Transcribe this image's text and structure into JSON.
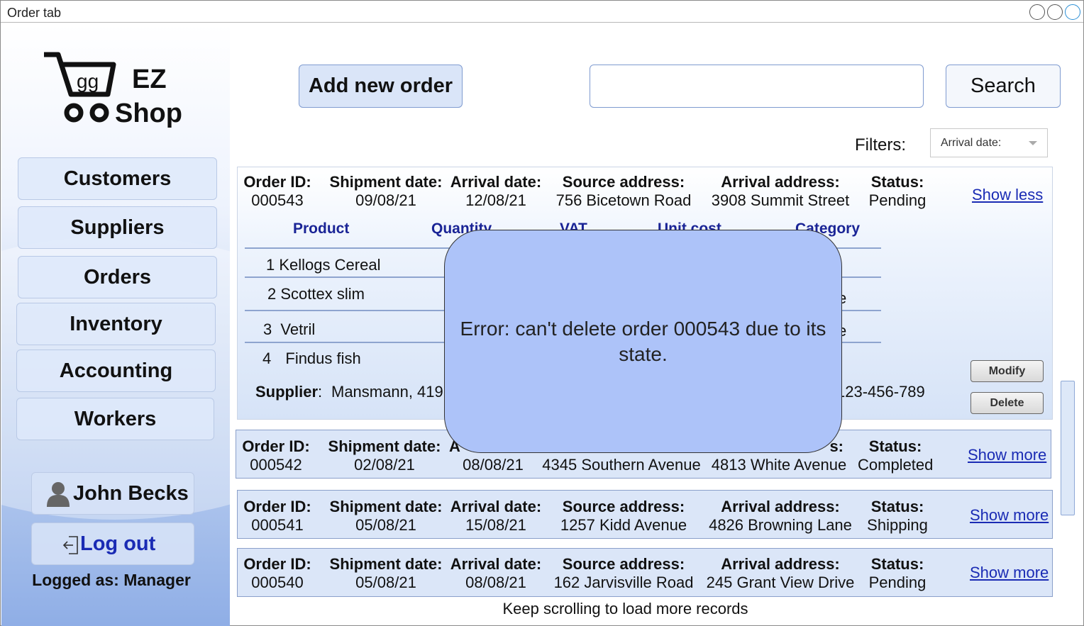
{
  "window": {
    "title": "Order tab"
  },
  "logo": {
    "cart_text": "gg",
    "line1": "EZ",
    "line2": "Shop"
  },
  "sidebar": {
    "items": [
      "Customers",
      "Suppliers",
      "Orders",
      "Inventory",
      "Accounting",
      "Workers"
    ],
    "user_name": "John Becks",
    "logout_label": "Log out",
    "logged_as": "Logged as: Manager"
  },
  "toolbar": {
    "add_label": "Add new order",
    "search_value": "",
    "search_label": "Search",
    "filters_label": "Filters:",
    "filter_value": "Arrival date:"
  },
  "labels": {
    "order_id": "Order ID:",
    "shipment": "Shipment date:",
    "arrival_date": "Arrival date:",
    "source": "Source address:",
    "arrival_address": "Arrival address:",
    "status": "Status:"
  },
  "expanded_order": {
    "id": "000543",
    "shipment": "09/08/21",
    "arrival": "12/08/21",
    "source": "756  Bicetown Road",
    "destination": "3908  Summit Street",
    "status": "Pending",
    "link": "Show less",
    "product_headers": {
      "product": "Product",
      "quantity": "Quantity",
      "vat": "VAT",
      "unit_cost": "Unit cost",
      "category": "Category"
    },
    "products": [
      {
        "num": "1",
        "name": "Kellogs Cereal",
        "category_tail": "l"
      },
      {
        "num": "2",
        "name": "Scottex slim",
        "category_tail": "e"
      },
      {
        "num": "3",
        "name": "Vetril",
        "category_tail": "e"
      },
      {
        "num": "4",
        "name": "Findus fish",
        "category_tail": ""
      }
    ],
    "supplier_label": "Supplier",
    "supplier_text": "Mansmann,  419",
    "phone_tail": "123-456-789",
    "modify_label": "Modify",
    "delete_label": "Delete"
  },
  "orders": [
    {
      "id": "000542",
      "shipment": "02/08/21",
      "arrival": "08/08/21",
      "source": "4345  Southern Avenue",
      "destination": "4813  White Avenue",
      "status": "Completed",
      "link": "Show more",
      "arrival_label_partial": "A",
      "addr_label_tail": "s:"
    },
    {
      "id": "000541",
      "shipment": "05/08/21",
      "arrival": "15/08/21",
      "source": "1257  Kidd Avenue",
      "destination": "4826  Browning Lane",
      "status": "Shipping",
      "link": "Show more"
    },
    {
      "id": "000540",
      "shipment": "05/08/21",
      "arrival": "08/08/21",
      "source": "162  Jarvisville Road",
      "destination": "245  Grant View Drive",
      "status": "Pending",
      "link": "Show more"
    }
  ],
  "footer": {
    "note": "Keep scrolling to load more records"
  },
  "modal": {
    "message": "Error: can't delete order 000543 due to its state."
  }
}
